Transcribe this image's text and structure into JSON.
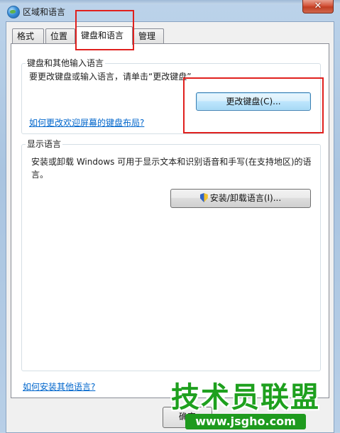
{
  "window": {
    "title": "区域和语言",
    "close_glyph": "✕"
  },
  "tabs": [
    {
      "label": "格式"
    },
    {
      "label": "位置"
    },
    {
      "label": "键盘和语言",
      "active": true
    },
    {
      "label": "管理"
    }
  ],
  "keyboard_group": {
    "title": "键盘和其他输入语言",
    "description": "要更改键盘或输入语言，请单击“更改键盘”",
    "change_button": "更改键盘(C)...",
    "welcome_link": "如何更改欢迎屏幕的键盘布局?"
  },
  "display_group": {
    "title": "显示语言",
    "description_line1": "安装或卸载 Windows 可用于显示文本和识别语音和手写(在支持地区)的语",
    "description_line2": "言。",
    "install_button": "安装/卸载语言(I)..."
  },
  "footer": {
    "help_link": "如何安装其他语言?",
    "ok_button_partial": "确定"
  },
  "watermark": {
    "main_text": "技术员联盟",
    "url_text": "www.jsgho.com"
  },
  "colors": {
    "highlight_box": "#e0201e",
    "link": "#0066cc",
    "watermark_green": "#1ea01e"
  }
}
